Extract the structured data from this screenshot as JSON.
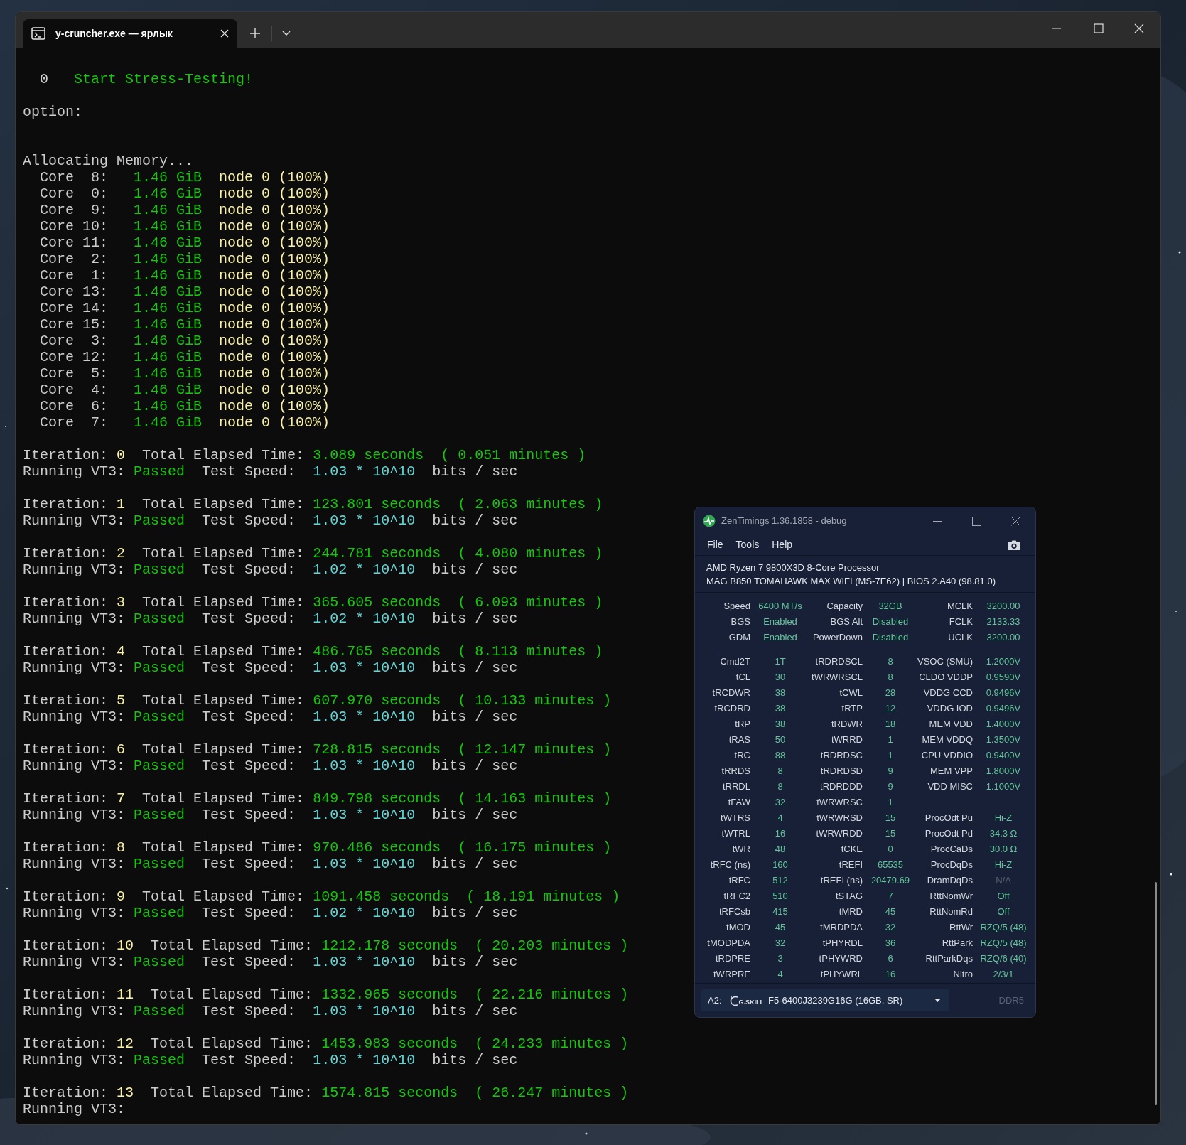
{
  "terminal": {
    "tab_title": "y-cruncher.exe — ярлык",
    "menu_item": {
      "number": "0",
      "label": "Start Stress-Testing!"
    },
    "prompt": "option:",
    "allocating": "Allocating Memory...",
    "cores": [
      {
        "label": "Core",
        "index": "8:",
        "size": "1.46 GiB",
        "node": "node 0 (100%)"
      },
      {
        "label": "Core",
        "index": "0:",
        "size": "1.46 GiB",
        "node": "node 0 (100%)"
      },
      {
        "label": "Core",
        "index": "9:",
        "size": "1.46 GiB",
        "node": "node 0 (100%)"
      },
      {
        "label": "Core",
        "index": "10:",
        "size": "1.46 GiB",
        "node": "node 0 (100%)"
      },
      {
        "label": "Core",
        "index": "11:",
        "size": "1.46 GiB",
        "node": "node 0 (100%)"
      },
      {
        "label": "Core",
        "index": "2:",
        "size": "1.46 GiB",
        "node": "node 0 (100%)"
      },
      {
        "label": "Core",
        "index": "1:",
        "size": "1.46 GiB",
        "node": "node 0 (100%)"
      },
      {
        "label": "Core",
        "index": "13:",
        "size": "1.46 GiB",
        "node": "node 0 (100%)"
      },
      {
        "label": "Core",
        "index": "14:",
        "size": "1.46 GiB",
        "node": "node 0 (100%)"
      },
      {
        "label": "Core",
        "index": "15:",
        "size": "1.46 GiB",
        "node": "node 0 (100%)"
      },
      {
        "label": "Core",
        "index": "3:",
        "size": "1.46 GiB",
        "node": "node 0 (100%)"
      },
      {
        "label": "Core",
        "index": "12:",
        "size": "1.46 GiB",
        "node": "node 0 (100%)"
      },
      {
        "label": "Core",
        "index": "5:",
        "size": "1.46 GiB",
        "node": "node 0 (100%)"
      },
      {
        "label": "Core",
        "index": "4:",
        "size": "1.46 GiB",
        "node": "node 0 (100%)"
      },
      {
        "label": "Core",
        "index": "6:",
        "size": "1.46 GiB",
        "node": "node 0 (100%)"
      },
      {
        "label": "Core",
        "index": "7:",
        "size": "1.46 GiB",
        "node": "node 0 (100%)"
      }
    ],
    "iterations": [
      {
        "label": "Iteration:",
        "number": "0",
        "elapsed_label": "Total Elapsed Time:",
        "seconds": "3.089 seconds",
        "minutes": "( 0.051 minutes )",
        "test": "Running VT3:",
        "result": "Passed",
        "speed_label": "Test Speed:",
        "speed": "1.03 * 10^10",
        "unit": "bits / sec"
      },
      {
        "label": "Iteration:",
        "number": "1",
        "elapsed_label": "Total Elapsed Time:",
        "seconds": "123.801 seconds",
        "minutes": "( 2.063 minutes )",
        "test": "Running VT3:",
        "result": "Passed",
        "speed_label": "Test Speed:",
        "speed": "1.03 * 10^10",
        "unit": "bits / sec"
      },
      {
        "label": "Iteration:",
        "number": "2",
        "elapsed_label": "Total Elapsed Time:",
        "seconds": "244.781 seconds",
        "minutes": "( 4.080 minutes )",
        "test": "Running VT3:",
        "result": "Passed",
        "speed_label": "Test Speed:",
        "speed": "1.02 * 10^10",
        "unit": "bits / sec"
      },
      {
        "label": "Iteration:",
        "number": "3",
        "elapsed_label": "Total Elapsed Time:",
        "seconds": "365.605 seconds",
        "minutes": "( 6.093 minutes )",
        "test": "Running VT3:",
        "result": "Passed",
        "speed_label": "Test Speed:",
        "speed": "1.02 * 10^10",
        "unit": "bits / sec"
      },
      {
        "label": "Iteration:",
        "number": "4",
        "elapsed_label": "Total Elapsed Time:",
        "seconds": "486.765 seconds",
        "minutes": "( 8.113 minutes )",
        "test": "Running VT3:",
        "result": "Passed",
        "speed_label": "Test Speed:",
        "speed": "1.03 * 10^10",
        "unit": "bits / sec"
      },
      {
        "label": "Iteration:",
        "number": "5",
        "elapsed_label": "Total Elapsed Time:",
        "seconds": "607.970 seconds",
        "minutes": "( 10.133 minutes )",
        "test": "Running VT3:",
        "result": "Passed",
        "speed_label": "Test Speed:",
        "speed": "1.03 * 10^10",
        "unit": "bits / sec"
      },
      {
        "label": "Iteration:",
        "number": "6",
        "elapsed_label": "Total Elapsed Time:",
        "seconds": "728.815 seconds",
        "minutes": "( 12.147 minutes )",
        "test": "Running VT3:",
        "result": "Passed",
        "speed_label": "Test Speed:",
        "speed": "1.03 * 10^10",
        "unit": "bits / sec"
      },
      {
        "label": "Iteration:",
        "number": "7",
        "elapsed_label": "Total Elapsed Time:",
        "seconds": "849.798 seconds",
        "minutes": "( 14.163 minutes )",
        "test": "Running VT3:",
        "result": "Passed",
        "speed_label": "Test Speed:",
        "speed": "1.03 * 10^10",
        "unit": "bits / sec"
      },
      {
        "label": "Iteration:",
        "number": "8",
        "elapsed_label": "Total Elapsed Time:",
        "seconds": "970.486 seconds",
        "minutes": "( 16.175 minutes )",
        "test": "Running VT3:",
        "result": "Passed",
        "speed_label": "Test Speed:",
        "speed": "1.03 * 10^10",
        "unit": "bits / sec"
      },
      {
        "label": "Iteration:",
        "number": "9",
        "elapsed_label": "Total Elapsed Time:",
        "seconds": "1091.458 seconds",
        "minutes": "( 18.191 minutes )",
        "test": "Running VT3:",
        "result": "Passed",
        "speed_label": "Test Speed:",
        "speed": "1.02 * 10^10",
        "unit": "bits / sec"
      },
      {
        "label": "Iteration:",
        "number": "10",
        "elapsed_label": "Total Elapsed Time:",
        "seconds": "1212.178 seconds",
        "minutes": "( 20.203 minutes )",
        "test": "Running VT3:",
        "result": "Passed",
        "speed_label": "Test Speed:",
        "speed": "1.03 * 10^10",
        "unit": "bits / sec"
      },
      {
        "label": "Iteration:",
        "number": "11",
        "elapsed_label": "Total Elapsed Time:",
        "seconds": "1332.965 seconds",
        "minutes": "( 22.216 minutes )",
        "test": "Running VT3:",
        "result": "Passed",
        "speed_label": "Test Speed:",
        "speed": "1.03 * 10^10",
        "unit": "bits / sec"
      },
      {
        "label": "Iteration:",
        "number": "12",
        "elapsed_label": "Total Elapsed Time:",
        "seconds": "1453.983 seconds",
        "minutes": "( 24.233 minutes )",
        "test": "Running VT3:",
        "result": "Passed",
        "speed_label": "Test Speed:",
        "speed": "1.03 * 10^10",
        "unit": "bits / sec"
      },
      {
        "label": "Iteration:",
        "number": "13",
        "elapsed_label": "Total Elapsed Time:",
        "seconds": "1574.815 seconds",
        "minutes": "( 26.247 minutes )",
        "test": "Running VT3:"
      }
    ]
  },
  "zentimings": {
    "title": "ZenTimings 1.36.1858 - debug",
    "menu": [
      "File",
      "Tools",
      "Help"
    ],
    "cpu": "AMD Ryzen 7 9800X3D 8-Core Processor",
    "board": "MAG B850 TOMAHAWK MAX WIFI (MS-7E62) | BIOS 2.A40 (98.81.0)",
    "summary": [
      {
        "cells": [
          {
            "label": "Speed",
            "value": "6400 MT/s",
            "disabled": false
          },
          {
            "label": "Capacity",
            "value": "32GB",
            "disabled": false
          },
          {
            "label": "MCLK",
            "value": "3200.00",
            "disabled": false
          }
        ]
      },
      {
        "cells": [
          {
            "label": "BGS",
            "value": "Enabled",
            "disabled": false
          },
          {
            "label": "BGS Alt",
            "value": "Disabled",
            "disabled": false
          },
          {
            "label": "FCLK",
            "value": "2133.33",
            "disabled": false
          }
        ]
      },
      {
        "cells": [
          {
            "label": "GDM",
            "value": "Enabled",
            "disabled": false
          },
          {
            "label": "PowerDown",
            "value": "Disabled",
            "disabled": false
          },
          {
            "label": "UCLK",
            "value": "3200.00",
            "disabled": false
          }
        ]
      }
    ],
    "timings": [
      {
        "cells": [
          {
            "label": "Cmd2T",
            "value": "1T",
            "disabled": false
          },
          {
            "label": "tRDRDSCL",
            "value": "8",
            "disabled": false
          },
          {
            "label": "VSOC (SMU)",
            "value": "1.2000V",
            "disabled": false
          }
        ]
      },
      {
        "cells": [
          {
            "label": "tCL",
            "value": "30",
            "disabled": false
          },
          {
            "label": "tWRWRSCL",
            "value": "8",
            "disabled": false
          },
          {
            "label": "CLDO VDDP",
            "value": "0.9590V",
            "disabled": false
          }
        ]
      },
      {
        "cells": [
          {
            "label": "tRCDWR",
            "value": "38",
            "disabled": false
          },
          {
            "label": "tCWL",
            "value": "28",
            "disabled": false
          },
          {
            "label": "VDDG CCD",
            "value": "0.9496V",
            "disabled": false
          }
        ]
      },
      {
        "cells": [
          {
            "label": "tRCDRD",
            "value": "38",
            "disabled": false
          },
          {
            "label": "tRTP",
            "value": "12",
            "disabled": false
          },
          {
            "label": "VDDG IOD",
            "value": "0.9496V",
            "disabled": false
          }
        ]
      },
      {
        "cells": [
          {
            "label": "tRP",
            "value": "38",
            "disabled": false
          },
          {
            "label": "tRDWR",
            "value": "18",
            "disabled": false
          },
          {
            "label": "MEM VDD",
            "value": "1.4000V",
            "disabled": false
          }
        ]
      },
      {
        "cells": [
          {
            "label": "tRAS",
            "value": "50",
            "disabled": false
          },
          {
            "label": "tWRRD",
            "value": "1",
            "disabled": false
          },
          {
            "label": "MEM VDDQ",
            "value": "1.3500V",
            "disabled": false
          }
        ]
      },
      {
        "cells": [
          {
            "label": "tRC",
            "value": "88",
            "disabled": false
          },
          {
            "label": "tRDRDSC",
            "value": "1",
            "disabled": false
          },
          {
            "label": "CPU VDDIO",
            "value": "0.9400V",
            "disabled": false
          }
        ]
      },
      {
        "cells": [
          {
            "label": "tRRDS",
            "value": "8",
            "disabled": false
          },
          {
            "label": "tRDRDSD",
            "value": "9",
            "disabled": false
          },
          {
            "label": "MEM VPP",
            "value": "1.8000V",
            "disabled": false
          }
        ]
      },
      {
        "cells": [
          {
            "label": "tRRDL",
            "value": "8",
            "disabled": false
          },
          {
            "label": "tRDRDDD",
            "value": "9",
            "disabled": false
          },
          {
            "label": "VDD MISC",
            "value": "1.1000V",
            "disabled": false
          }
        ]
      },
      {
        "cells": [
          {
            "label": "tFAW",
            "value": "32",
            "disabled": false
          },
          {
            "label": "tWRWRSC",
            "value": "1",
            "disabled": false
          }
        ]
      },
      {
        "cells": [
          {
            "label": "tWTRS",
            "value": "4",
            "disabled": false
          },
          {
            "label": "tWRWRSD",
            "value": "15",
            "disabled": false
          },
          {
            "label": "ProcOdt Pu",
            "value": "Hi-Z",
            "disabled": false
          }
        ]
      },
      {
        "cells": [
          {
            "label": "tWTRL",
            "value": "16",
            "disabled": false
          },
          {
            "label": "tWRWRDD",
            "value": "15",
            "disabled": false
          },
          {
            "label": "ProcOdt Pd",
            "value": "34.3 Ω",
            "disabled": false
          }
        ]
      },
      {
        "cells": [
          {
            "label": "tWR",
            "value": "48",
            "disabled": false
          },
          {
            "label": "tCKE",
            "value": "0",
            "disabled": false
          },
          {
            "label": "ProcCaDs",
            "value": "30.0 Ω",
            "disabled": false
          }
        ]
      },
      {
        "cells": [
          {
            "label": "tRFC (ns)",
            "value": "160",
            "disabled": false
          },
          {
            "label": "tREFI",
            "value": "65535",
            "disabled": false
          },
          {
            "label": "ProcDqDs",
            "value": "Hi-Z",
            "disabled": false
          }
        ]
      },
      {
        "cells": [
          {
            "label": "tRFC",
            "value": "512",
            "disabled": false
          },
          {
            "label": "tREFI (ns)",
            "value": "20479.69",
            "disabled": false
          },
          {
            "label": "DramDqDs",
            "value": "N/A",
            "disabled": true
          }
        ]
      },
      {
        "cells": [
          {
            "label": "tRFC2",
            "value": "510",
            "disabled": false
          },
          {
            "label": "tSTAG",
            "value": "7",
            "disabled": false
          },
          {
            "label": "RttNomWr",
            "value": "Off",
            "disabled": false
          }
        ]
      },
      {
        "cells": [
          {
            "label": "tRFCsb",
            "value": "415",
            "disabled": false
          },
          {
            "label": "tMRD",
            "value": "45",
            "disabled": false
          },
          {
            "label": "RttNomRd",
            "value": "Off",
            "disabled": false
          }
        ]
      },
      {
        "cells": [
          {
            "label": "tMOD",
            "value": "45",
            "disabled": false
          },
          {
            "label": "tMRDPDA",
            "value": "32",
            "disabled": false
          },
          {
            "label": "RttWr",
            "value": "RZQ/5 (48)",
            "disabled": false
          }
        ]
      },
      {
        "cells": [
          {
            "label": "tMODPDA",
            "value": "32",
            "disabled": false
          },
          {
            "label": "tPHYRDL",
            "value": "36",
            "disabled": false
          },
          {
            "label": "RttPark",
            "value": "RZQ/5 (48)",
            "disabled": false
          }
        ]
      },
      {
        "cells": [
          {
            "label": "tRDPRE",
            "value": "3",
            "disabled": false
          },
          {
            "label": "tPHYWRD",
            "value": "6",
            "disabled": false
          },
          {
            "label": "RttParkDqs",
            "value": "RZQ/6 (40)",
            "disabled": false
          }
        ]
      },
      {
        "cells": [
          {
            "label": "tWRPRE",
            "value": "4",
            "disabled": false
          },
          {
            "label": "tPHYWRL",
            "value": "16",
            "disabled": false
          },
          {
            "label": "Nitro",
            "value": "2/3/1",
            "disabled": false
          }
        ]
      }
    ],
    "module": {
      "slot": "A2:",
      "logo_text": "G.SKILL",
      "name": "F5-6400J3239G16G (16GB, SR)"
    },
    "memory_type": "DDR5"
  }
}
